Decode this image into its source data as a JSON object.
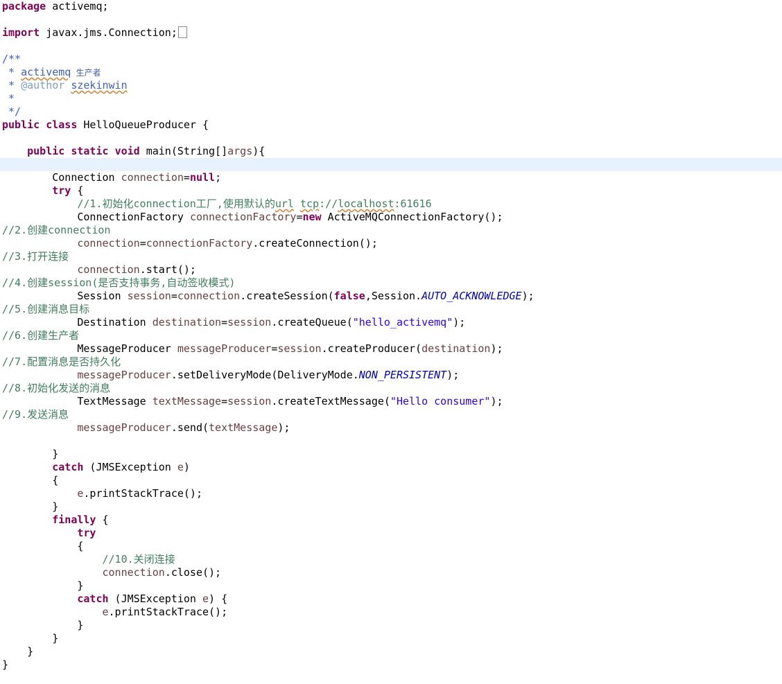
{
  "code": {
    "l_package": "package",
    "l_package_name": " activemq;",
    "l_import": "import",
    "l_import_name": " javax.jms.Connection;",
    "l_doc_open": "/**",
    "l_doc_star1": " * ",
    "l_doc_activemq": "activemq",
    "l_doc_producer": " 生产者",
    "l_doc_star2": " * ",
    "l_doc_author": "@author",
    "l_doc_space": " ",
    "l_doc_name": "szekinwin",
    "l_doc_star3": " *",
    "l_doc_close": " */",
    "l_public": "public",
    "l_class": "class",
    "l_class_name": " HelloQueueProducer {",
    "l_main_public": "public",
    "l_main_static": "static",
    "l_main_void": "void",
    "l_main_sig": " main(String[]",
    "l_main_args": "args",
    "l_main_end": "){",
    "l_conn_type": "Connection ",
    "l_conn_var": "connection",
    "l_conn_eq": "=",
    "l_null": "null",
    "l_semi": ";",
    "l_try": "try",
    "l_try_brace": " {",
    "c1_a": "//1.初始化connection工厂,使用默认的",
    "c1_url": "url",
    "c1_sp": " ",
    "c1_tcp": "tcp",
    "c1_mid": "://",
    "c1_localhost": "localhost",
    "c1_port": ":61616",
    "f_type": "ConnectionFactory ",
    "f_var": "connectionFactory",
    "f_eq": "=",
    "f_new": "new",
    "f_rest": " ActiveMQConnectionFactory();",
    "c2": "//2.创建connection",
    "cc_var": "connection",
    "cc_eq": "=",
    "cc_fac": "connectionFactory",
    "cc_rest": ".createConnection();",
    "c3": "//3.打开连接",
    "st_var": "connection",
    "st_rest": ".start();",
    "c4": "//4.创建session(是否支持事务,自动签收模式)",
    "s_type": "Session ",
    "s_var": "session",
    "s_eq": "=",
    "s_conn": "connection",
    "s_call": ".createSession(",
    "s_false": "false",
    "s_sess": ",Session.",
    "s_field": "AUTO_ACKNOWLEDGE",
    "s_end": ");",
    "c5": "//5.创建消息目标",
    "d_type": "Destination ",
    "d_var": "destination",
    "d_eq": "=",
    "d_sess": "session",
    "d_call": ".createQueue(",
    "d_str": "\"hello_activemq\"",
    "d_end": ");",
    "c6": "//6.创建生产者",
    "p_type": "MessageProducer ",
    "p_var": "messageProducer",
    "p_eq": "=",
    "p_sess": "session",
    "p_call": ".createProducer(",
    "p_dest": "destination",
    "p_end": ");",
    "c7": "//7.配置消息是否持久化",
    "m_var": "messageProducer",
    "m_call": ".setDeliveryMode(DeliveryMode.",
    "m_field": "NON_PERSISTENT",
    "m_end": ");",
    "c8": "//8.初始化发送的消息",
    "t_type": "TextMessage ",
    "t_var": "textMessage",
    "t_eq": "=",
    "t_sess": "session",
    "t_call": ".createTextMessage(",
    "t_str": "\"Hello consumer\"",
    "t_end": ");",
    "c9": "//9.发送消息",
    "sd_var": "messageProducer",
    "sd_call": ".send(",
    "sd_arg": "textMessage",
    "sd_end": ");",
    "close_brace": "}",
    "catch_kw": "catch",
    "catch_sig": " (JMSException ",
    "catch_e": "e",
    "catch_end": ")",
    "open_brace": "{",
    "pst_e": "e",
    "pst_rest": ".printStackTrace();",
    "finally_kw": "finally",
    "finally_brace": " {",
    "try2_kw": "try",
    "c10": "//10.关闭连接",
    "cl_var": "connection",
    "cl_rest": ".close();",
    "catch2_end": ") {"
  }
}
